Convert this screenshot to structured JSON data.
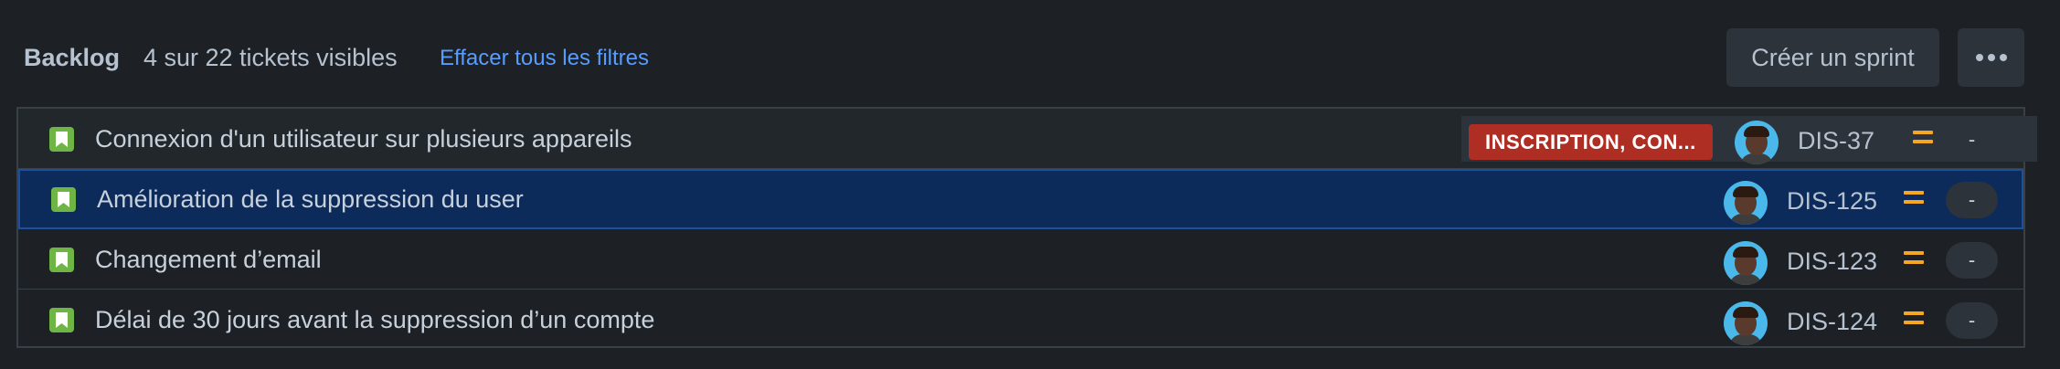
{
  "backlog": {
    "title": "Backlog",
    "count_text": "4 sur 22 tickets visibles",
    "clear_filters": "Effacer tous les filtres",
    "create_sprint": "Créer un sprint",
    "more_icon": "more-horizontal-icon"
  },
  "issues": [
    {
      "summary": "Connexion d'un utilisateur sur plusieurs appareils",
      "label": "INSCRIPTION, CON...",
      "key": "DIS-37",
      "estimate": "-",
      "type_icon": "story-icon",
      "priority": "medium"
    },
    {
      "summary": "Amélioration de la suppression du user",
      "key": "DIS-125",
      "estimate": "-",
      "type_icon": "story-icon",
      "priority": "medium"
    },
    {
      "summary": "Changement d’email",
      "key": "DIS-123",
      "estimate": "-",
      "type_icon": "story-icon",
      "priority": "medium"
    },
    {
      "summary": "Délai de 30 jours avant la suppression d’un compte",
      "key": "DIS-124",
      "estimate": "-",
      "type_icon": "story-icon",
      "priority": "medium"
    }
  ],
  "colors": {
    "background": "#1d2125",
    "selected_row": "#0c2a5a",
    "story": "#6eb546",
    "label_red": "#ae2e24",
    "priority_medium": "#f5a623",
    "link": "#579dff"
  }
}
